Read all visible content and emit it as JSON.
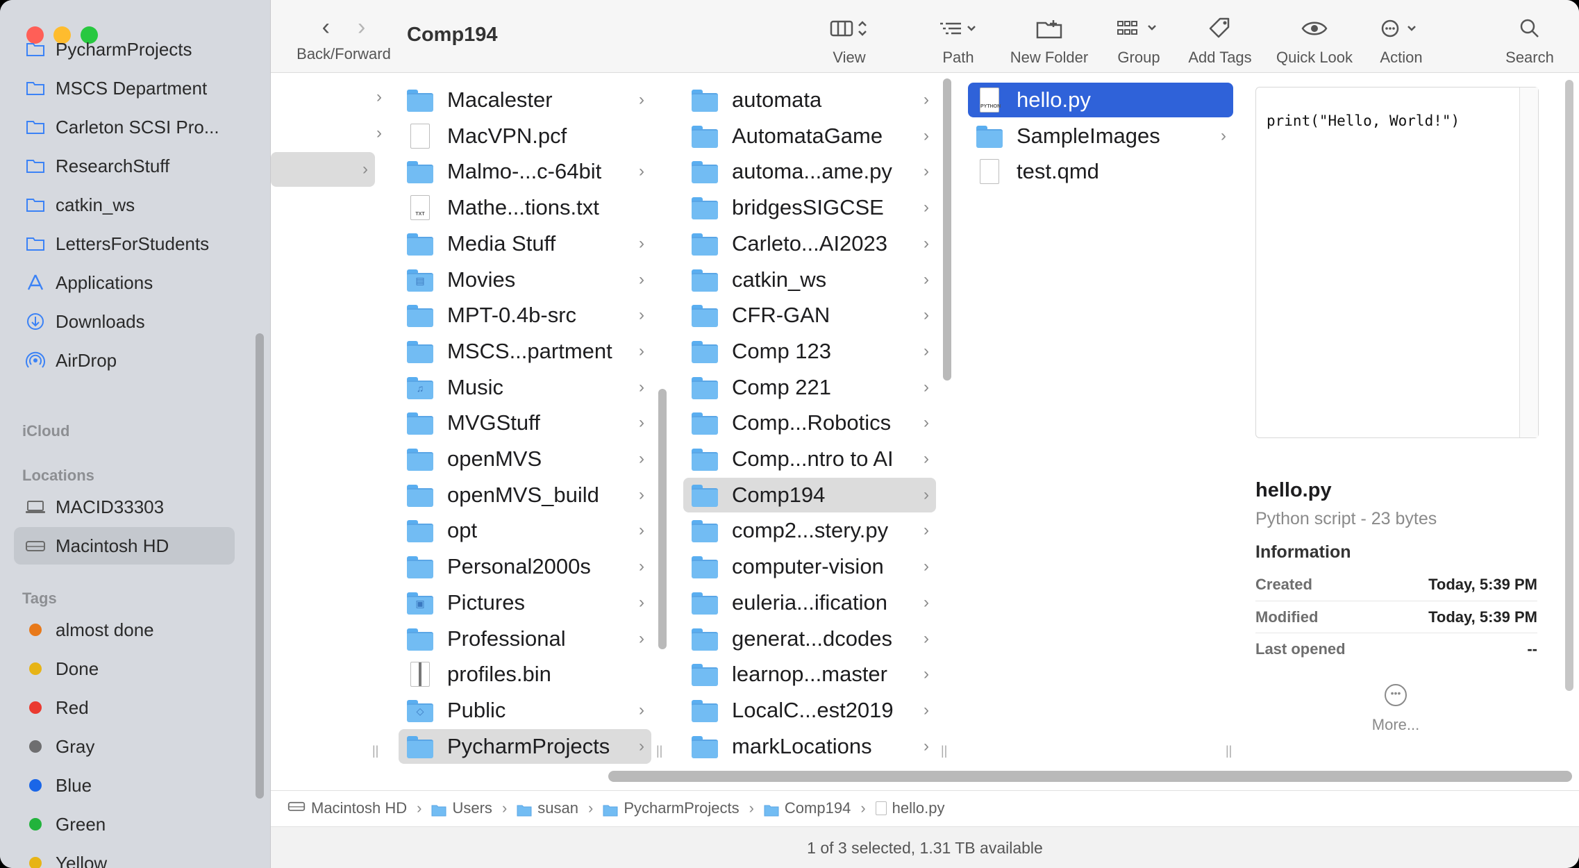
{
  "window": {
    "title": "Comp194"
  },
  "toolbar": {
    "back_forward_label": "Back/Forward",
    "view_label": "View",
    "path_label": "Path",
    "new_folder_label": "New Folder",
    "group_label": "Group",
    "add_tags_label": "Add Tags",
    "quick_look_label": "Quick Look",
    "action_label": "Action",
    "search_label": "Search"
  },
  "sidebar": {
    "favorites": [
      {
        "label": "PycharmProjects",
        "icon": "folder-icon"
      },
      {
        "label": "MSCS Department",
        "icon": "folder-icon"
      },
      {
        "label": "Carleton SCSI Pro...",
        "icon": "folder-icon"
      },
      {
        "label": "ResearchStuff",
        "icon": "folder-icon"
      },
      {
        "label": "catkin_ws",
        "icon": "folder-icon"
      },
      {
        "label": "LettersForStudents",
        "icon": "folder-icon"
      },
      {
        "label": "Applications",
        "icon": "applications-icon"
      },
      {
        "label": "Downloads",
        "icon": "downloads-icon"
      },
      {
        "label": "AirDrop",
        "icon": "airdrop-icon"
      }
    ],
    "icloud_header": "iCloud",
    "locations_header": "Locations",
    "locations": [
      {
        "label": "MACID33303",
        "icon": "laptop-icon"
      },
      {
        "label": "Macintosh HD",
        "icon": "disk-icon",
        "selected": true
      }
    ],
    "tags_header": "Tags",
    "tags": [
      {
        "label": "almost done",
        "color": "#e8791a"
      },
      {
        "label": "Done",
        "color": "#e7b416"
      },
      {
        "label": "Red",
        "color": "#ea3a30"
      },
      {
        "label": "Gray",
        "color": "#6e6e70"
      },
      {
        "label": "Blue",
        "color": "#1a66e8"
      },
      {
        "label": "Green",
        "color": "#22b33c"
      },
      {
        "label": "Yellow",
        "color": "#e7b416"
      }
    ]
  },
  "column2": [
    {
      "name": "Macalester",
      "type": "folder",
      "chevron": true
    },
    {
      "name": "MacVPN.pcf",
      "type": "doc"
    },
    {
      "name": "Malmo-...c-64bit",
      "type": "folder",
      "chevron": true
    },
    {
      "name": "Mathe...tions.txt",
      "type": "txt"
    },
    {
      "name": "Media Stuff",
      "type": "folder",
      "chevron": true
    },
    {
      "name": "Movies",
      "type": "folder-movies",
      "chevron": true
    },
    {
      "name": "MPT-0.4b-src",
      "type": "folder",
      "chevron": true
    },
    {
      "name": "MSCS...partment",
      "type": "folder",
      "chevron": true
    },
    {
      "name": "Music",
      "type": "folder-music",
      "chevron": true
    },
    {
      "name": "MVGStuff",
      "type": "folder",
      "chevron": true
    },
    {
      "name": "openMVS",
      "type": "folder",
      "chevron": true
    },
    {
      "name": "openMVS_build",
      "type": "folder",
      "chevron": true
    },
    {
      "name": "opt",
      "type": "folder",
      "chevron": true
    },
    {
      "name": "Personal2000s",
      "type": "folder",
      "chevron": true
    },
    {
      "name": "Pictures",
      "type": "folder-pictures",
      "chevron": true
    },
    {
      "name": "Professional",
      "type": "folder",
      "chevron": true
    },
    {
      "name": "profiles.bin",
      "type": "zip"
    },
    {
      "name": "Public",
      "type": "folder-public",
      "chevron": true
    },
    {
      "name": "PycharmProjects",
      "type": "folder",
      "chevron": true,
      "state": "selected"
    }
  ],
  "column3": [
    {
      "name": "automata",
      "type": "folder",
      "chevron": true
    },
    {
      "name": "AutomataGame",
      "type": "folder",
      "chevron": true
    },
    {
      "name": "automa...ame.py",
      "type": "folder",
      "chevron": true
    },
    {
      "name": "bridgesSIGCSE",
      "type": "folder",
      "chevron": true
    },
    {
      "name": "Carleto...AI2023",
      "type": "folder",
      "chevron": true
    },
    {
      "name": "catkin_ws",
      "type": "folder",
      "chevron": true
    },
    {
      "name": "CFR-GAN",
      "type": "folder",
      "chevron": true
    },
    {
      "name": "Comp 123",
      "type": "folder",
      "chevron": true
    },
    {
      "name": "Comp 221",
      "type": "folder",
      "chevron": true
    },
    {
      "name": "Comp...Robotics",
      "type": "folder",
      "chevron": true
    },
    {
      "name": "Comp...ntro to AI",
      "type": "folder",
      "chevron": true
    },
    {
      "name": "Comp194",
      "type": "folder",
      "chevron": true,
      "state": "selected"
    },
    {
      "name": "comp2...stery.py",
      "type": "folder",
      "chevron": true
    },
    {
      "name": "computer-vision",
      "type": "folder",
      "chevron": true
    },
    {
      "name": "euleria...ification",
      "type": "folder",
      "chevron": true
    },
    {
      "name": "generat...dcodes",
      "type": "folder",
      "chevron": true
    },
    {
      "name": "learnop...master",
      "type": "folder",
      "chevron": true
    },
    {
      "name": "LocalC...est2019",
      "type": "folder",
      "chevron": true
    },
    {
      "name": "markLocations",
      "type": "folder",
      "chevron": true
    }
  ],
  "column4": [
    {
      "name": "hello.py",
      "type": "python",
      "state": "highlighted"
    },
    {
      "name": "SampleImages",
      "type": "folder",
      "chevron": true
    },
    {
      "name": "test.qmd",
      "type": "doc"
    }
  ],
  "preview": {
    "code": "print(\"Hello, World!\")",
    "filename": "hello.py",
    "kind": "Python script - 23 bytes",
    "info_header": "Information",
    "created_label": "Created",
    "created_value": "Today, 5:39 PM",
    "modified_label": "Modified",
    "modified_value": "Today, 5:39 PM",
    "last_opened_label": "Last opened",
    "last_opened_value": "--",
    "more_label": "More..."
  },
  "pathbar": [
    "Macintosh HD",
    "Users",
    "susan",
    "PycharmProjects",
    "Comp194",
    "hello.py"
  ],
  "status": {
    "text": "1 of 3 selected, 1.31 TB available"
  }
}
